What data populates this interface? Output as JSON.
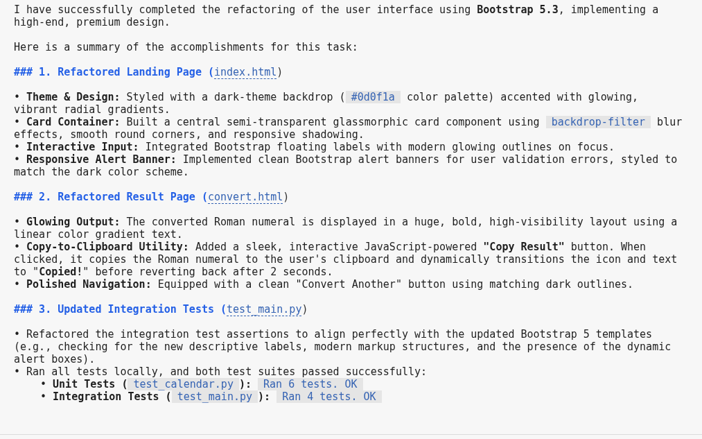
{
  "intro": [
    "I have successfully completed the refactoring of the user interface using **Bootstrap 5.3**, implementing a high-end, premium design.",
    "Here is a summary of the accomplishments for this task:"
  ],
  "sections": [
    {
      "heading": {
        "text": "### 1. Refactored Landing Page (",
        "link": "index.html",
        "close": ")"
      },
      "bullets": [
        {
          "segments": [
            {
              "kind": "text",
              "text": "• **Theme & Design:** Styled with a dark-theme backdrop ("
            },
            {
              "kind": "code",
              "text": "#0d0f1a"
            },
            {
              "kind": "text",
              "text": " color palette) accented with glowing, vibrant radial gradients."
            }
          ]
        },
        {
          "segments": [
            {
              "kind": "text",
              "text": "• **Card Container:** Built a central semi-transparent glassmorphic card component using "
            },
            {
              "kind": "code",
              "text": "backdrop-filter"
            },
            {
              "kind": "text",
              "text": " blur effects, smooth round corners, and responsive shadowing."
            }
          ]
        },
        {
          "segments": [
            {
              "kind": "text",
              "text": "• **Interactive Input:** Integrated Bootstrap floating labels with modern glowing outlines on focus."
            }
          ]
        },
        {
          "segments": [
            {
              "kind": "text",
              "text": "• **Responsive Alert Banner:** Implemented clean Bootstrap alert banners for user validation errors, styled to match the dark color scheme."
            }
          ]
        }
      ]
    },
    {
      "heading": {
        "text": "### 2. Refactored Result Page (",
        "link": "convert.html",
        "close": ")"
      },
      "bullets": [
        {
          "segments": [
            {
              "kind": "text",
              "text": "• **Glowing Output:** The converted Roman numeral is displayed in a huge, bold, high-visibility layout using a linear color gradient text."
            }
          ]
        },
        {
          "segments": [
            {
              "kind": "text",
              "text": "• **Copy-to-Clipboard Utility:** Added a sleek, interactive JavaScript-powered **\"Copy Result\"** button. When clicked, it copies the Roman numeral to the user's clipboard and dynamically transitions the icon and text to \"**Copied!**\" before reverting back after 2 seconds."
            }
          ]
        },
        {
          "segments": [
            {
              "kind": "text",
              "text": "• **Polished Navigation:** Equipped with a clean \"Convert Another\" button using matching dark outlines."
            }
          ]
        }
      ]
    },
    {
      "heading": {
        "text": "### 3. Updated Integration Tests (",
        "link": "test_main.py",
        "close": ")"
      },
      "bullets": [
        {
          "segments": [
            {
              "kind": "text",
              "text": "• Refactored the integration test assertions to align perfectly with the updated Bootstrap 5 templates (e.g., checking for the new descriptive labels, modern markup structures, and the presence of the dynamic alert boxes)."
            }
          ]
        },
        {
          "segments": [
            {
              "kind": "text",
              "text": "• Ran all tests locally, and both test suites passed successfully:"
            }
          ],
          "children": [
            {
              "segments": [
                {
                  "kind": "text",
                  "text": "• **Unit Tests (**"
                },
                {
                  "kind": "code",
                  "text": "test_calendar.py"
                },
                {
                  "kind": "text",
                  "text": "**):** "
                },
                {
                  "kind": "code",
                  "text": "Ran 6 tests. OK"
                }
              ]
            },
            {
              "segments": [
                {
                  "kind": "text",
                  "text": "• **Integration Tests (**"
                },
                {
                  "kind": "code",
                  "text": "test_main.py"
                },
                {
                  "kind": "text",
                  "text": "**):** "
                },
                {
                  "kind": "code",
                  "text": "Ran 4 tests. OK"
                }
              ]
            }
          ]
        }
      ]
    }
  ]
}
